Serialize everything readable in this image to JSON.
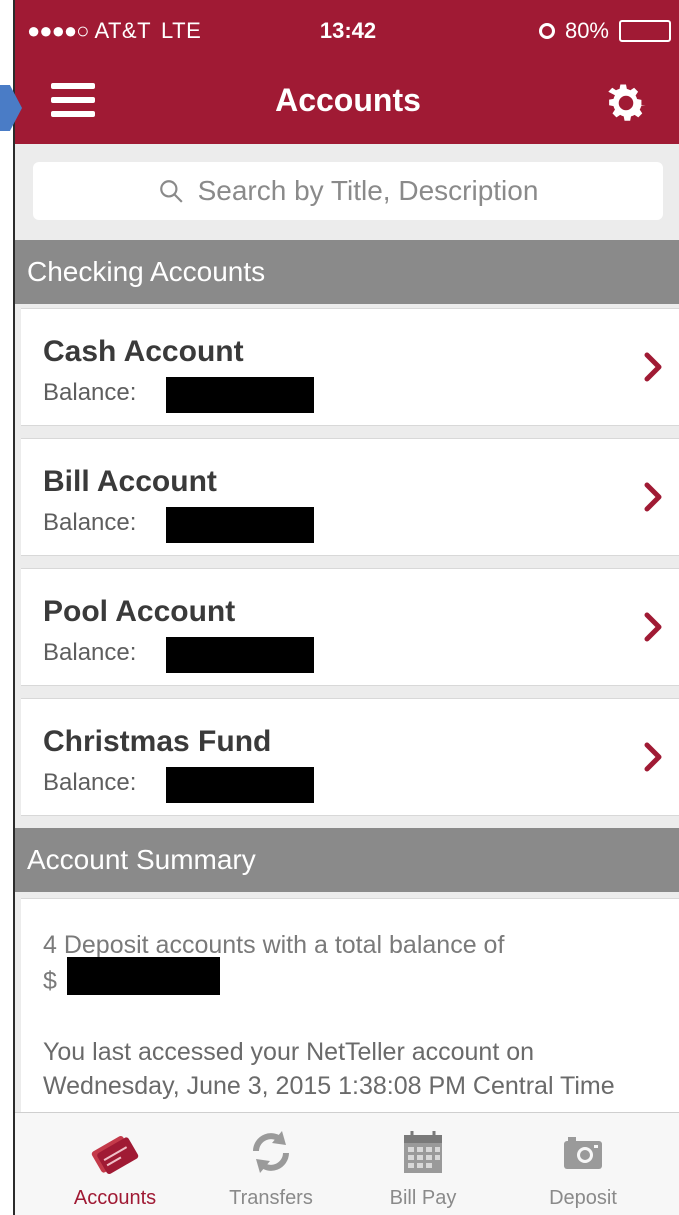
{
  "status_bar": {
    "signal": "●●●●○",
    "carrier": "AT&T",
    "network": "LTE",
    "time": "13:42",
    "battery_percent": "80%",
    "battery_level": 0.8
  },
  "header": {
    "title": "Accounts"
  },
  "search": {
    "placeholder": "Search by Title, Description"
  },
  "sections": {
    "checking_title": "Checking Accounts",
    "summary_title": "Account Summary"
  },
  "accounts": [
    {
      "name": "Cash Account",
      "balance_label": "Balance:"
    },
    {
      "name": "Bill Account",
      "balance_label": "Balance:"
    },
    {
      "name": "Pool Account",
      "balance_label": "Balance:"
    },
    {
      "name": "Christmas Fund",
      "balance_label": "Balance:"
    }
  ],
  "summary": {
    "deposit_text": "4 Deposit accounts with a total balance of",
    "currency_prefix": "$",
    "last_access_text": "You last accessed your NetTeller account on Wednesday, June 3, 2015 1:38:08 PM Central Time"
  },
  "tabs": [
    {
      "label": "Accounts",
      "icon": "card-icon"
    },
    {
      "label": "Transfers",
      "icon": "refresh-icon"
    },
    {
      "label": "Bill Pay",
      "icon": "calendar-icon"
    },
    {
      "label": "Deposit",
      "icon": "camera-icon"
    }
  ],
  "colors": {
    "brand": "#a01a34",
    "section_header": "#8a8a8a",
    "background": "#ececec"
  }
}
